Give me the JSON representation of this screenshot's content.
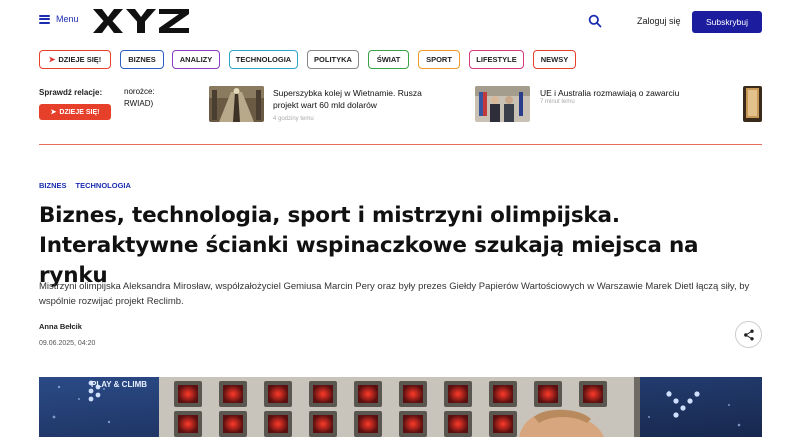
{
  "header": {
    "menu_label": "Menu",
    "logo_text": "XYZ",
    "login_label": "Zaloguj się",
    "subscribe_label": "Subskrybuj"
  },
  "nav_pills": [
    {
      "label": "DZIEJE SIĘ!",
      "color": "#e6402b"
    },
    {
      "label": "BIZNES",
      "color": "#2a5fc1"
    },
    {
      "label": "ANALIZY",
      "color": "#8a3cc2"
    },
    {
      "label": "TECHNOLOGIA",
      "color": "#2fa3c8"
    },
    {
      "label": "POLITYKA",
      "color": "#888888"
    },
    {
      "label": "ŚWIAT",
      "color": "#3aa34a"
    },
    {
      "label": "SPORT",
      "color": "#f09a2a"
    },
    {
      "label": "LIFESTYLE",
      "color": "#d63a7a"
    },
    {
      "label": "NEWSY",
      "color": "#e6402b"
    }
  ],
  "relations": {
    "label": "Sprawdź relacje:",
    "button_label": "DZIEJE SIĘ!",
    "cut_text_1": "norożce:",
    "cut_text_2": "RWIAD)"
  },
  "news": [
    {
      "title_line1": "Superszybka kolej w Wietnamie. Rusza",
      "title_line2": "projekt wart 60 mld dolarów",
      "time": "4 godziny temu"
    },
    {
      "title_line1": "UE i Australia rozmawiają o zawarciu",
      "title_line2": "",
      "time": "7 minut temu"
    }
  ],
  "article": {
    "breadcrumbs": [
      "BIZNES",
      "TECHNOLOGIA"
    ],
    "title_line1": "Biznes, technologia, sport i mistrzyni olimpijska.",
    "title_line2": "Interaktywne ścianki wspinaczkowe szukają miejsca na rynku",
    "lead": "Mistrzyni olimpijska Aleksandra Mirosław, współzałożyciel Gemiusa Marcin Pery oraz były prezes Giełdy Papierów Wartościowych w Warszawie Marek Dietl łączą siły, by wspólnie rozwijać projekt Reclimb.",
    "author": "Anna Bełcik",
    "date": "09.06.2025, 04:20",
    "hero_sign": "PLAY & CLIMB"
  },
  "colors": {
    "brand_blue": "#1b1c9e",
    "accent_red": "#e6402b"
  }
}
